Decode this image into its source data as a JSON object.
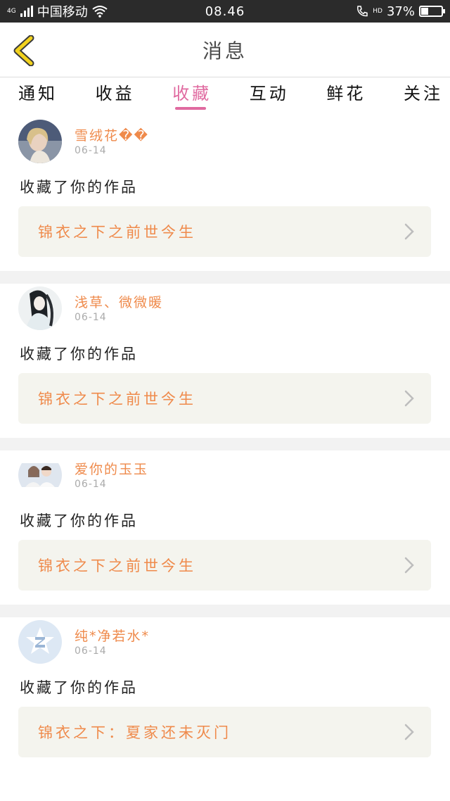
{
  "status_bar": {
    "network": "4G",
    "carrier": "中国移动",
    "time": "08.46",
    "hd": "HD",
    "battery": "37%",
    "battery_level": 0.37
  },
  "header": {
    "title": "消息"
  },
  "tabs": [
    {
      "label": "通知",
      "active": false
    },
    {
      "label": "收益",
      "active": false
    },
    {
      "label": "收藏",
      "active": true
    },
    {
      "label": "互动",
      "active": false
    },
    {
      "label": "鲜花",
      "active": false
    },
    {
      "label": "关注",
      "active": false
    }
  ],
  "messages": [
    {
      "user": "雪绒花��",
      "date": "06-14",
      "action": "收藏了你的作品",
      "work": "锦衣之下之前世今生",
      "avatar": "avatar-girl-photo"
    },
    {
      "user": "浅草、微微暖",
      "date": "06-14",
      "action": "收藏了你的作品",
      "work": "锦衣之下之前世今生",
      "avatar": "avatar-illustration"
    },
    {
      "user": "爱你的玉玉",
      "date": "06-14",
      "action": "收藏了你的作品",
      "work": "锦衣之下之前世今生",
      "avatar": "avatar-couple-photo"
    },
    {
      "user": "纯*净若水*",
      "date": "06-14",
      "action": "收藏了你的作品",
      "work": "锦衣之下：夏家还未灭门",
      "avatar": "avatar-default-qq"
    }
  ],
  "colors": {
    "accent_orange": "#ef8a4b",
    "accent_pink": "#e06aa0",
    "card_bg": "#f4f4ee",
    "back_yellow": "#f2d21e"
  }
}
